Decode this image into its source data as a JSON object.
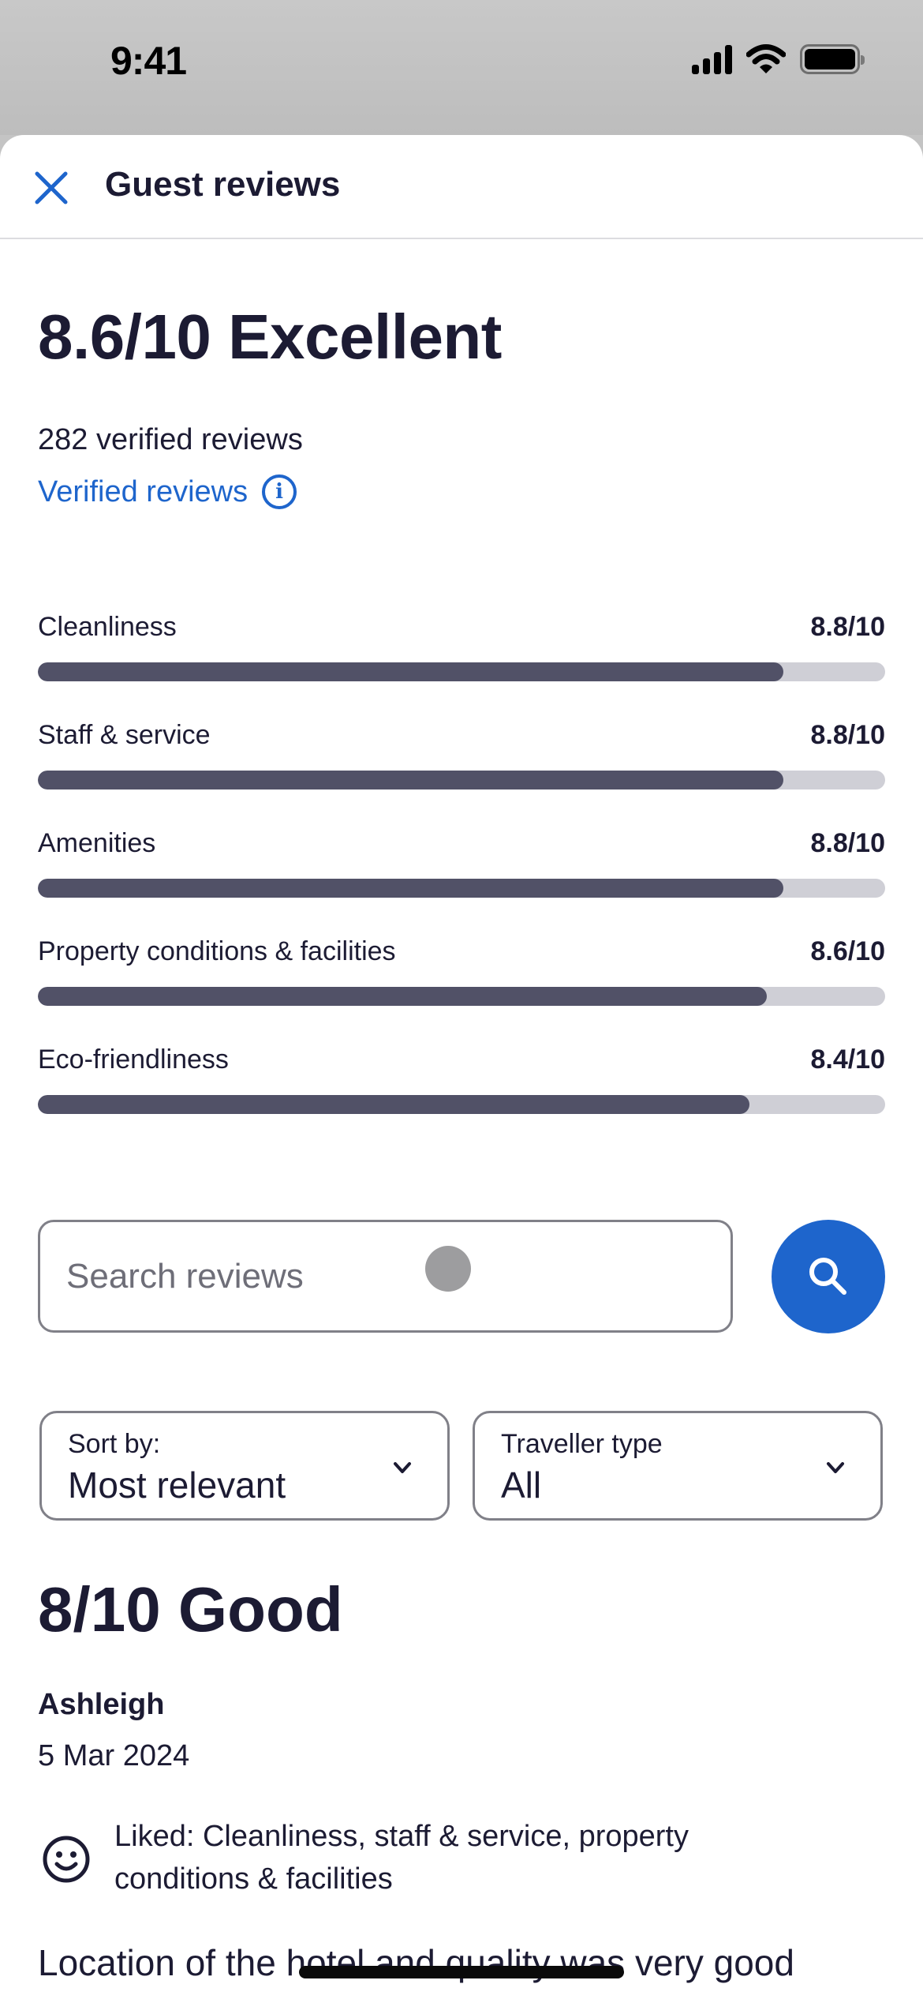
{
  "status_bar": {
    "time": "9:41",
    "icons": [
      "cellular-signal-icon",
      "wifi-icon",
      "battery-icon"
    ]
  },
  "header": {
    "close_icon": "close-icon",
    "title": "Guest reviews"
  },
  "summary": {
    "overall_text": "8.6/10 Excellent",
    "overall_score": 8.6,
    "overall_max": 10,
    "rating_label": "Excellent",
    "review_count_text": "282 verified reviews",
    "verified_link_label": "Verified reviews",
    "info_icon": "info-icon"
  },
  "categories": [
    {
      "label": "Cleanliness",
      "value_text": "8.8/10",
      "score": 8.8,
      "max": 10
    },
    {
      "label": "Staff & service",
      "value_text": "8.8/10",
      "score": 8.8,
      "max": 10
    },
    {
      "label": "Amenities",
      "value_text": "8.8/10",
      "score": 8.8,
      "max": 10
    },
    {
      "label": "Property conditions & facilities",
      "value_text": "8.6/10",
      "score": 8.6,
      "max": 10
    },
    {
      "label": "Eco-friendliness",
      "value_text": "8.4/10",
      "score": 8.4,
      "max": 10
    }
  ],
  "search": {
    "placeholder": "Search reviews",
    "value": "",
    "button_icon": "search-icon"
  },
  "filters": {
    "sort": {
      "label": "Sort by:",
      "value": "Most relevant"
    },
    "traveller_type": {
      "label": "Traveller type",
      "value": "All"
    }
  },
  "review": {
    "score_text": "8/10 Good",
    "reviewer": "Ashleigh",
    "date": "5 Mar 2024",
    "liked_text": "Liked: Cleanliness, staff & service, property conditions & facilities",
    "body": "Location of the hotel and quality was very good"
  },
  "colors": {
    "accent": "#1e65cc",
    "text": "#1c1b33",
    "bar_fill": "#515167",
    "bar_track": "#cfcfd6"
  }
}
